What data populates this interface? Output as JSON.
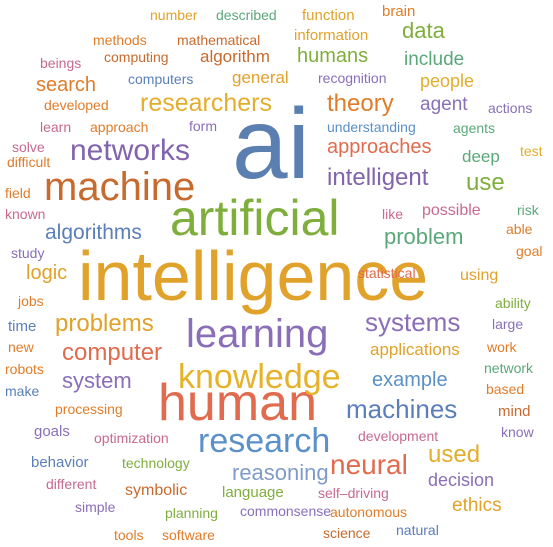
{
  "words": [
    {
      "text": "ai",
      "color": "#5b7fb0"
    },
    {
      "text": "intelligence",
      "color": "#e0a22a"
    },
    {
      "text": "artificial",
      "color": "#7fae3c"
    },
    {
      "text": "human",
      "color": "#e06b4e"
    },
    {
      "text": "learning",
      "color": "#8a6fb8"
    },
    {
      "text": "machine",
      "color": "#c76a2e"
    },
    {
      "text": "knowledge",
      "color": "#e5b22a"
    },
    {
      "text": "research",
      "color": "#5b90c8"
    },
    {
      "text": "networks",
      "color": "#8264ac"
    },
    {
      "text": "researchers",
      "color": "#e2ae2c"
    },
    {
      "text": "systems",
      "color": "#8a6fb8"
    },
    {
      "text": "neural",
      "color": "#e06b4e"
    },
    {
      "text": "machines",
      "color": "#5b7fb8"
    },
    {
      "text": "problems",
      "color": "#e0a22a"
    },
    {
      "text": "intelligent",
      "color": "#8264ac"
    },
    {
      "text": "computer",
      "color": "#e06b4e"
    },
    {
      "text": "theory",
      "color": "#e07d2a"
    },
    {
      "text": "data",
      "color": "#7fae3c"
    },
    {
      "text": "humans",
      "color": "#7fae3c"
    },
    {
      "text": "approaches",
      "color": "#e06b4e"
    },
    {
      "text": "use",
      "color": "#7fae3c"
    },
    {
      "text": "problem",
      "color": "#5aa87a"
    },
    {
      "text": "algorithms",
      "color": "#5b7fb8"
    },
    {
      "text": "system",
      "color": "#8a6fb8"
    },
    {
      "text": "example",
      "color": "#5b90c8"
    },
    {
      "text": "used",
      "color": "#e2ae2c"
    },
    {
      "text": "reasoning",
      "color": "#7f9cc8"
    },
    {
      "text": "logic",
      "color": "#e0a22a"
    },
    {
      "text": "applications",
      "color": "#e0a22a"
    },
    {
      "text": "general",
      "color": "#e0a22a"
    },
    {
      "text": "search",
      "color": "#e07d2a"
    },
    {
      "text": "agent",
      "color": "#8a6fb8"
    },
    {
      "text": "deep",
      "color": "#5aa87a"
    },
    {
      "text": "include",
      "color": "#5aa87a"
    },
    {
      "text": "people",
      "color": "#e2ae2c"
    },
    {
      "text": "possible",
      "color": "#c76a8e"
    },
    {
      "text": "decision",
      "color": "#8a6fb8"
    },
    {
      "text": "ethics",
      "color": "#e0a22a"
    },
    {
      "text": "using",
      "color": "#e0a22a"
    },
    {
      "text": "algorithm",
      "color": "#c76a2e"
    },
    {
      "text": "information",
      "color": "#e0a22a"
    },
    {
      "text": "function",
      "color": "#e0a22a"
    },
    {
      "text": "brain",
      "color": "#e07d2a"
    },
    {
      "text": "number",
      "color": "#e0a22a"
    },
    {
      "text": "described",
      "color": "#5aa87a"
    },
    {
      "text": "methods",
      "color": "#e07d2a"
    },
    {
      "text": "mathematical",
      "color": "#c76a2e"
    },
    {
      "text": "beings",
      "color": "#c76a8e"
    },
    {
      "text": "computing",
      "color": "#c76a2e"
    },
    {
      "text": "computers",
      "color": "#5b7fb8"
    },
    {
      "text": "recognition",
      "color": "#8a6fb8"
    },
    {
      "text": "developed",
      "color": "#e07d2a"
    },
    {
      "text": "actions",
      "color": "#8a6fb8"
    },
    {
      "text": "learn",
      "color": "#c76a8e"
    },
    {
      "text": "approach",
      "color": "#e07d2a"
    },
    {
      "text": "form",
      "color": "#8a6fb8"
    },
    {
      "text": "understanding",
      "color": "#5b90c8"
    },
    {
      "text": "agents",
      "color": "#5aa87a"
    },
    {
      "text": "solve",
      "color": "#c76a8e"
    },
    {
      "text": "difficult",
      "color": "#e07d2a"
    },
    {
      "text": "test",
      "color": "#e2ae2c"
    },
    {
      "text": "field",
      "color": "#e07d2a"
    },
    {
      "text": "known",
      "color": "#c76a8e"
    },
    {
      "text": "like",
      "color": "#c76a8e"
    },
    {
      "text": "risk",
      "color": "#5aa87a"
    },
    {
      "text": "able",
      "color": "#e07d2a"
    },
    {
      "text": "goal",
      "color": "#e07d2a"
    },
    {
      "text": "study",
      "color": "#8a6fb8"
    },
    {
      "text": "statistical",
      "color": "#e06b4e"
    },
    {
      "text": "jobs",
      "color": "#e07d2a"
    },
    {
      "text": "ability",
      "color": "#7fae3c"
    },
    {
      "text": "large",
      "color": "#8a6fb8"
    },
    {
      "text": "time",
      "color": "#5b7fb8"
    },
    {
      "text": "new",
      "color": "#e07d2a"
    },
    {
      "text": "work",
      "color": "#e07d2a"
    },
    {
      "text": "robots",
      "color": "#e07d2a"
    },
    {
      "text": "network",
      "color": "#5aa87a"
    },
    {
      "text": "make",
      "color": "#5b7fb8"
    },
    {
      "text": "based",
      "color": "#e07d2a"
    },
    {
      "text": "processing",
      "color": "#e07d2a"
    },
    {
      "text": "mind",
      "color": "#c76a2e"
    },
    {
      "text": "goals",
      "color": "#8a6fb8"
    },
    {
      "text": "optimization",
      "color": "#c76a8e"
    },
    {
      "text": "development",
      "color": "#c76a8e"
    },
    {
      "text": "know",
      "color": "#8a6fb8"
    },
    {
      "text": "behavior",
      "color": "#5b7fb8"
    },
    {
      "text": "technology",
      "color": "#7fae3c"
    },
    {
      "text": "different",
      "color": "#c76a8e"
    },
    {
      "text": "symbolic",
      "color": "#c76a2e"
    },
    {
      "text": "language",
      "color": "#7fae3c"
    },
    {
      "text": "self–driving",
      "color": "#c76a8e"
    },
    {
      "text": "simple",
      "color": "#8a6fb8"
    },
    {
      "text": "commonsense",
      "color": "#8a6fb8"
    },
    {
      "text": "autonomous",
      "color": "#e07d2a"
    },
    {
      "text": "planning",
      "color": "#7fae3c"
    },
    {
      "text": "tools",
      "color": "#e07d2a"
    },
    {
      "text": "software",
      "color": "#e07d2a"
    },
    {
      "text": "science",
      "color": "#c76a2e"
    },
    {
      "text": "natural",
      "color": "#5b7fb8"
    }
  ]
}
